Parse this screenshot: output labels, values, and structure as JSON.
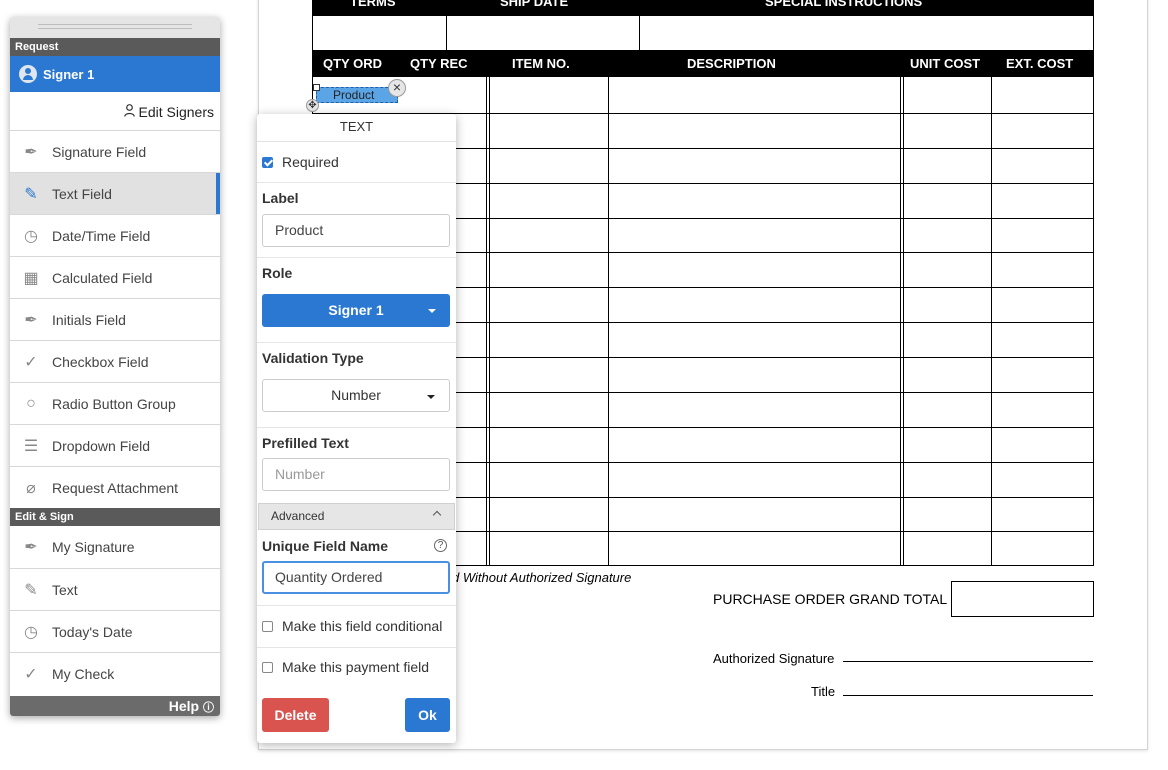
{
  "document": {
    "top_headers": [
      "TERMS",
      "SHIP DATE",
      "SPECIAL INSTRUCTIONS"
    ],
    "columns": [
      "QTY ORD",
      "QTY REC",
      "ITEM NO.",
      "DESCRIPTION",
      "UNIT COST",
      "EXT. COST"
    ],
    "void_text": "d Without Authorized Signature",
    "grand_total_label": "PURCHASE ORDER GRAND TOTAL",
    "authorized_signature_label": "Authorized Signature",
    "title_label": "Title",
    "placed_field_label": "Product"
  },
  "panel": {
    "request_header": "Request",
    "signer": "Signer 1",
    "edit_signers": "Edit Signers",
    "request_items": [
      {
        "label": "Signature Field",
        "icon": "pen-nib-icon"
      },
      {
        "label": "Text Field",
        "icon": "pencil-icon",
        "selected": true
      },
      {
        "label": "Date/Time Field",
        "icon": "clock-icon"
      },
      {
        "label": "Calculated Field",
        "icon": "calculator-icon"
      },
      {
        "label": "Initials Field",
        "icon": "pen-nib-icon"
      },
      {
        "label": "Checkbox Field",
        "icon": "checkmark-icon"
      },
      {
        "label": "Radio Button Group",
        "icon": "radio-icon"
      },
      {
        "label": "Dropdown Field",
        "icon": "dropdown-icon"
      },
      {
        "label": "Request Attachment",
        "icon": "paperclip-icon"
      }
    ],
    "edit_sign_header": "Edit & Sign",
    "edit_items": [
      {
        "label": "My Signature",
        "icon": "pen-nib-icon"
      },
      {
        "label": "Text",
        "icon": "pencil-icon"
      },
      {
        "label": "Today's Date",
        "icon": "clock-icon"
      },
      {
        "label": "My Check",
        "icon": "checkmark-icon"
      }
    ],
    "help": "Help"
  },
  "popup": {
    "title": "TEXT",
    "required_label": "Required",
    "required_checked": true,
    "label_heading": "Label",
    "label_value": "Product",
    "role_heading": "Role",
    "role_value": "Signer 1",
    "validation_heading": "Validation Type",
    "validation_value": "Number",
    "prefilled_heading": "Prefilled Text",
    "prefilled_placeholder": "Number",
    "advanced": "Advanced",
    "unique_name_heading": "Unique Field Name",
    "unique_name_value": "Quantity Ordered",
    "conditional_label": "Make this field conditional",
    "payment_label": "Make this payment field",
    "delete_label": "Delete",
    "ok_label": "Ok"
  },
  "colors": {
    "accent": "#2a78d1",
    "danger": "#d9534f",
    "panel_header": "#5a5a5a"
  }
}
